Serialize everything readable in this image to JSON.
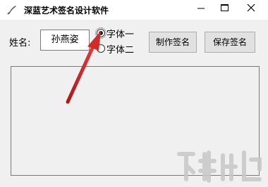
{
  "window": {
    "title": "深蓝艺术签名设计软件",
    "icon": "quill-pen-icon"
  },
  "controls": {
    "minimize_icon": "minimize-icon",
    "maximize_icon": "maximize-icon",
    "close_icon": "close-icon"
  },
  "form": {
    "name_label": "姓名:",
    "name_value": "孙燕姿",
    "font_options": [
      {
        "label": "字体一",
        "checked": true
      },
      {
        "label": "字体二",
        "checked": false
      }
    ],
    "make_button": "制作签名",
    "save_button": "保存签名"
  },
  "annotation": {
    "arrow_color": "#d42a2a",
    "arrow_icon": "red-arrow-pointer"
  },
  "colors": {
    "background": "#f0f0f0",
    "button_face": "#e1e1e1"
  }
}
